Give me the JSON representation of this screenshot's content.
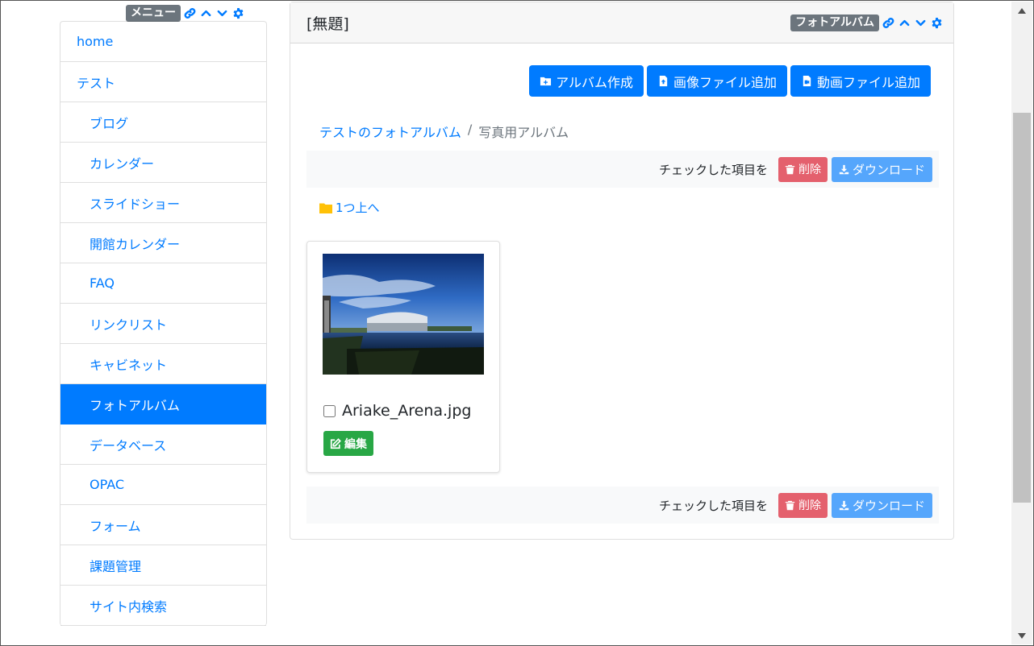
{
  "menu": {
    "badge": "メニュー",
    "items": [
      {
        "label": "home"
      },
      {
        "label": "テスト"
      },
      {
        "label": "ブログ"
      },
      {
        "label": "カレンダー"
      },
      {
        "label": "スライドショー"
      },
      {
        "label": "開館カレンダー"
      },
      {
        "label": "FAQ"
      },
      {
        "label": "リンクリスト"
      },
      {
        "label": "キャビネット"
      },
      {
        "label": "フォトアルバム"
      },
      {
        "label": "データベース"
      },
      {
        "label": "OPAC"
      },
      {
        "label": "フォーム"
      },
      {
        "label": "課題管理"
      },
      {
        "label": "サイト内検索"
      }
    ],
    "active_item": "フォトアルバム"
  },
  "frame": {
    "title": "[無題]",
    "badge": "フォトアルバム"
  },
  "toolbar": {
    "create_album": "アルバム作成",
    "add_image": "画像ファイル追加",
    "add_video": "動画ファイル追加"
  },
  "breadcrumb": {
    "parent": "テストのフォトアルバム",
    "separator": "/",
    "current": "写真用アルバム"
  },
  "actions": {
    "label": "チェックした項目を",
    "delete": "削除",
    "download": "ダウンロード"
  },
  "up_link": "1つ上へ",
  "photo": {
    "filename": "Ariake_Arena.jpg",
    "edit_label": "編集",
    "checked": false
  },
  "colors": {
    "primary": "#007bff",
    "danger": "#e4606d",
    "info": "#55a6fc",
    "success": "#28a745",
    "folder": "#ffc107",
    "badge": "#6c757d"
  }
}
